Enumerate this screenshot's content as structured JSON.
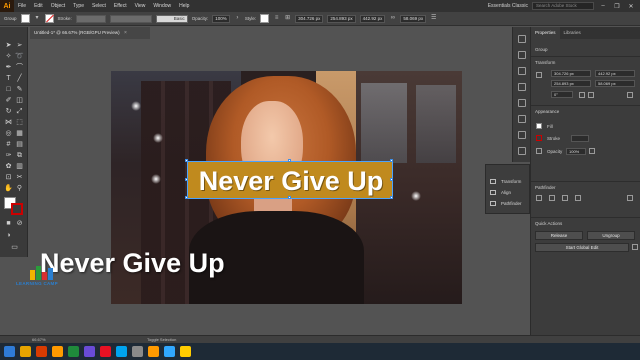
{
  "app": {
    "logo": "Ai",
    "workspace": "Essentials Classic",
    "search_placeholder": "Search Adobe Stock"
  },
  "menu": [
    "File",
    "Edit",
    "Object",
    "Type",
    "Select",
    "Effect",
    "View",
    "Window",
    "Help"
  ],
  "window_buttons": [
    "–",
    "❐",
    "✕"
  ],
  "control_bar": {
    "selection_label": "Group",
    "stroke_label": "Stroke:",
    "brush_label": "Basic",
    "opacity_label": "Opacity:",
    "opacity_value": "100%",
    "style_label": "Style:",
    "x_value": "304.726 px",
    "y_value": "254.893 px",
    "w_value": "442.92 px",
    "h_value": "58.069 px"
  },
  "document": {
    "tab_title": "Untitled-1* @ 66.67% (RGB/GPU Preview)",
    "close": "×"
  },
  "artwork": {
    "banner_text": "Never Give Up",
    "overlay_text": "Never Give Up",
    "watermark": "LEARNING CAMP",
    "colors": {
      "banner": "#c08a1e",
      "selection": "#4aa3ff"
    }
  },
  "float_panel": {
    "items": [
      "Transform",
      "Align",
      "Pathfinder"
    ]
  },
  "properties": {
    "tabs": [
      "Properties",
      "Libraries"
    ],
    "selection": "Group",
    "transform_title": "Transform",
    "x": "304.726 px",
    "y": "254.893 px",
    "w": "442.92 px",
    "h": "58.069 px",
    "rotate": "0°",
    "appearance_title": "Appearance",
    "fill_label": "Fill",
    "stroke_label": "Stroke",
    "opacity_label": "Opacity",
    "opacity_value": "100%",
    "pathfinder_title": "Pathfinder",
    "quick_actions_title": "Quick Actions",
    "release_button": "Release",
    "ungroup_button": "Ungroup",
    "global_edit_button": "Start Global Edit"
  },
  "status": {
    "zoom": "66.67%",
    "tool": "Toggle Selection"
  },
  "taskbar": {
    "icon_colors": [
      "#2f7bd6",
      "#e6a400",
      "#d83b01",
      "#ff9a00",
      "#1f8a3b",
      "#6a4bd6",
      "#e81123",
      "#00a4ef",
      "#8a8a8a",
      "#ff9a00",
      "#31a8ff",
      "#ffcc00"
    ],
    "time": "",
    "date": ""
  }
}
